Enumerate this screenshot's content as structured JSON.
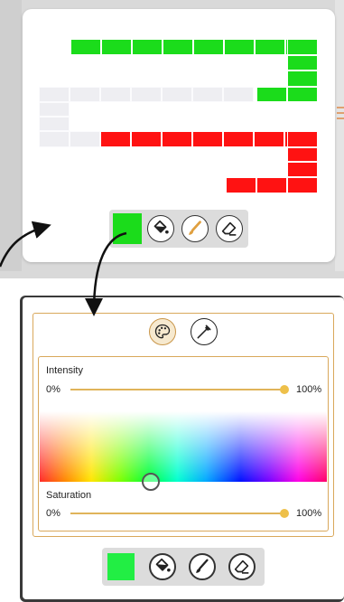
{
  "top_screen": {
    "selected_color": "#1bdc1b",
    "grid_colors": {
      "green": "#1bdc1b",
      "red": "#ff1212",
      "empty": "#eeeef2"
    },
    "toolbar": {
      "color_swatch_icon": "color-swatch-icon",
      "fill_icon": "paint-bucket-icon",
      "brush_icon": "brush-icon",
      "eraser_icon": "eraser-icon"
    }
  },
  "color_panel": {
    "mode_buttons": {
      "palette_icon": "palette-icon",
      "picker_icon": "eyedropper-icon"
    },
    "intensity": {
      "label": "Intensity",
      "min_label": "0%",
      "max_label": "100%",
      "value": 1.0
    },
    "saturation": {
      "label": "Saturation",
      "min_label": "0%",
      "max_label": "100%",
      "value": 1.0
    },
    "accent_color": "#d9a85b"
  },
  "bottom_toolbar": {
    "selected_color": "#22ee44",
    "fill_icon": "paint-bucket-icon",
    "brush_icon": "brush-icon",
    "eraser_icon": "eraser-icon"
  }
}
